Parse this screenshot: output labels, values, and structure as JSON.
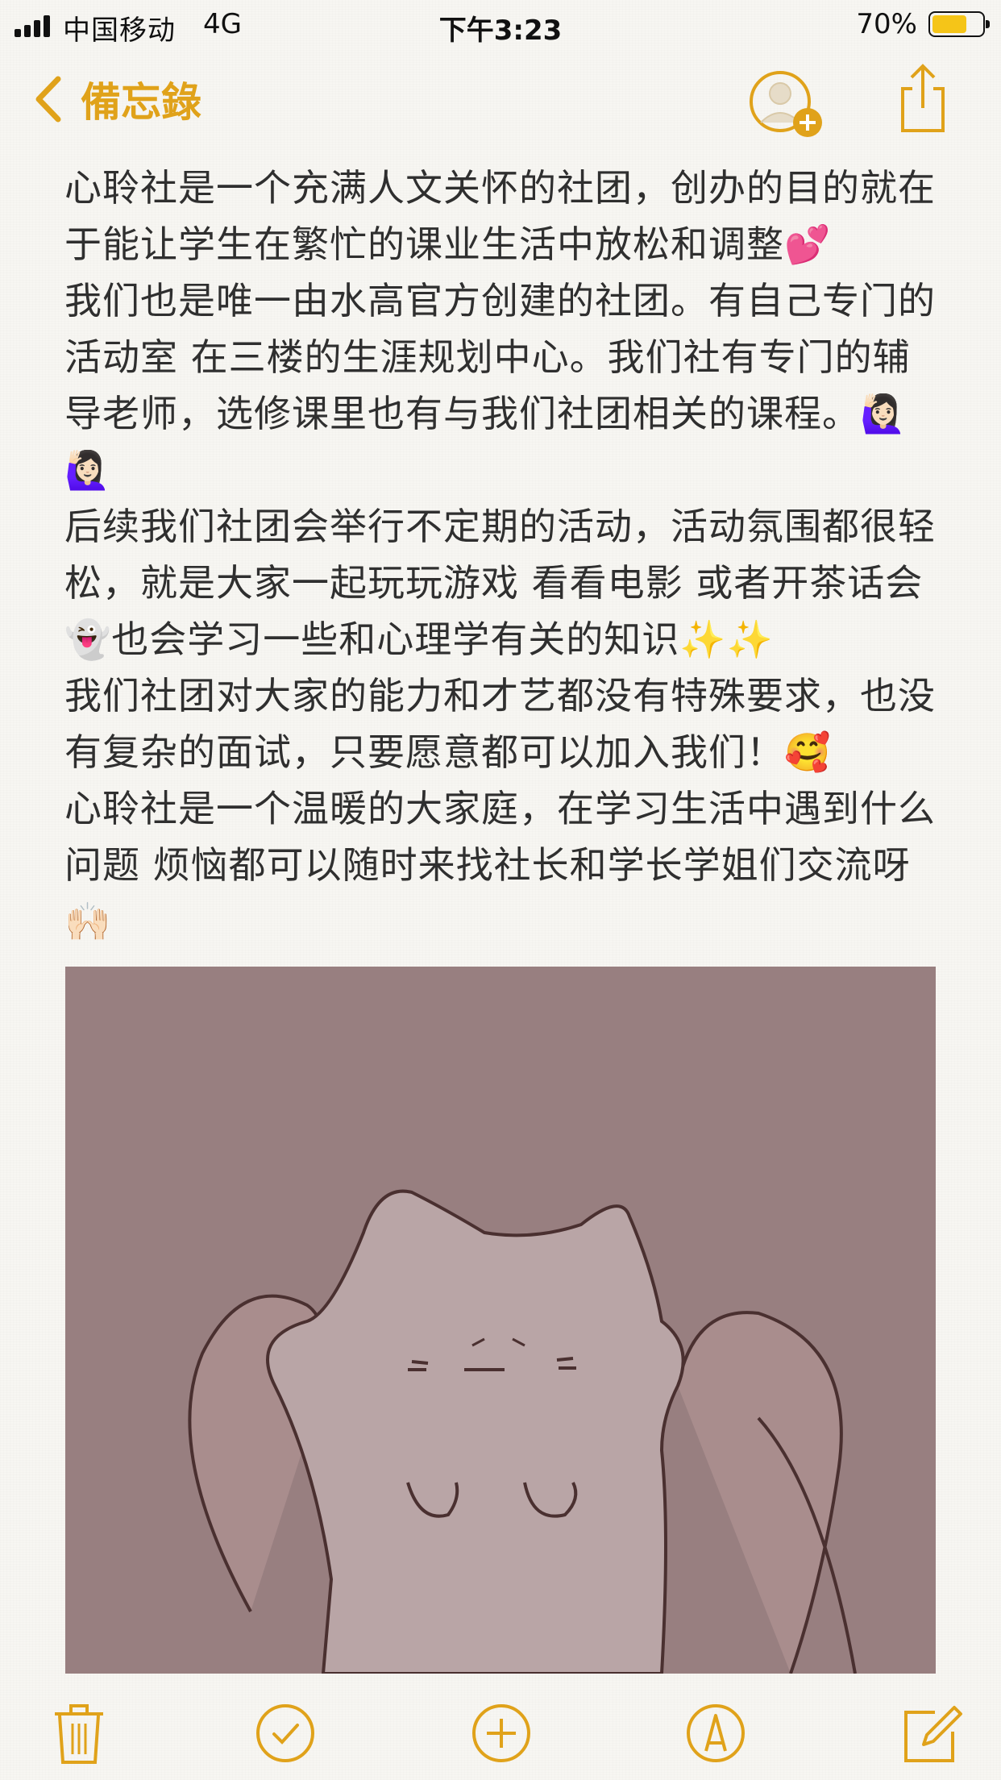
{
  "status_bar": {
    "carrier": "中国移动",
    "network": "4G",
    "time": "下午3:23",
    "battery_percent": "70%",
    "battery_level": 0.7,
    "signal_bars": 4
  },
  "nav": {
    "back_label": "備忘錄",
    "back_icon": "chevron-left-icon",
    "add_person_icon": "add-person-icon",
    "share_icon": "share-icon"
  },
  "note": {
    "paragraphs": [
      "心聆社是一个充满人文关怀的社团，创办的目的就在于能让学生在繁忙的课业生活中放松和调整💕",
      "我们也是唯一由水高官方创建的社团。有自己专门的活动室 在三楼的生涯规划中心。我们社有专门的辅导老师，选修课里也有与我们社团相关的课程。🙋🏻‍♀️🙋🏻‍♀️",
      "后续我们社团会举行不定期的活动，活动氛围都很轻松，就是大家一起玩玩游戏 看看电影 或者开茶话会👻也会学习一些和心理学有关的知识✨✨",
      "我们社团对大家的能力和才艺都没有特殊要求，也没有复杂的面试，只要愿意都可以加入我们！🥰",
      "心聆社是一个温暖的大家庭，在学习生活中遇到什么问题 烦恼都可以随时来找社长和学长学姐们交流呀🙌🏻"
    ],
    "image": "cartoon-cat-illustration"
  },
  "toolbar": {
    "items": [
      "trash-icon",
      "checklist-icon",
      "add-icon",
      "markup-icon",
      "compose-icon"
    ]
  },
  "colors": {
    "accent": "#e0a21a",
    "background": "#f7f6f2",
    "image_background": "#987f80",
    "text": "#2f2f2f"
  }
}
